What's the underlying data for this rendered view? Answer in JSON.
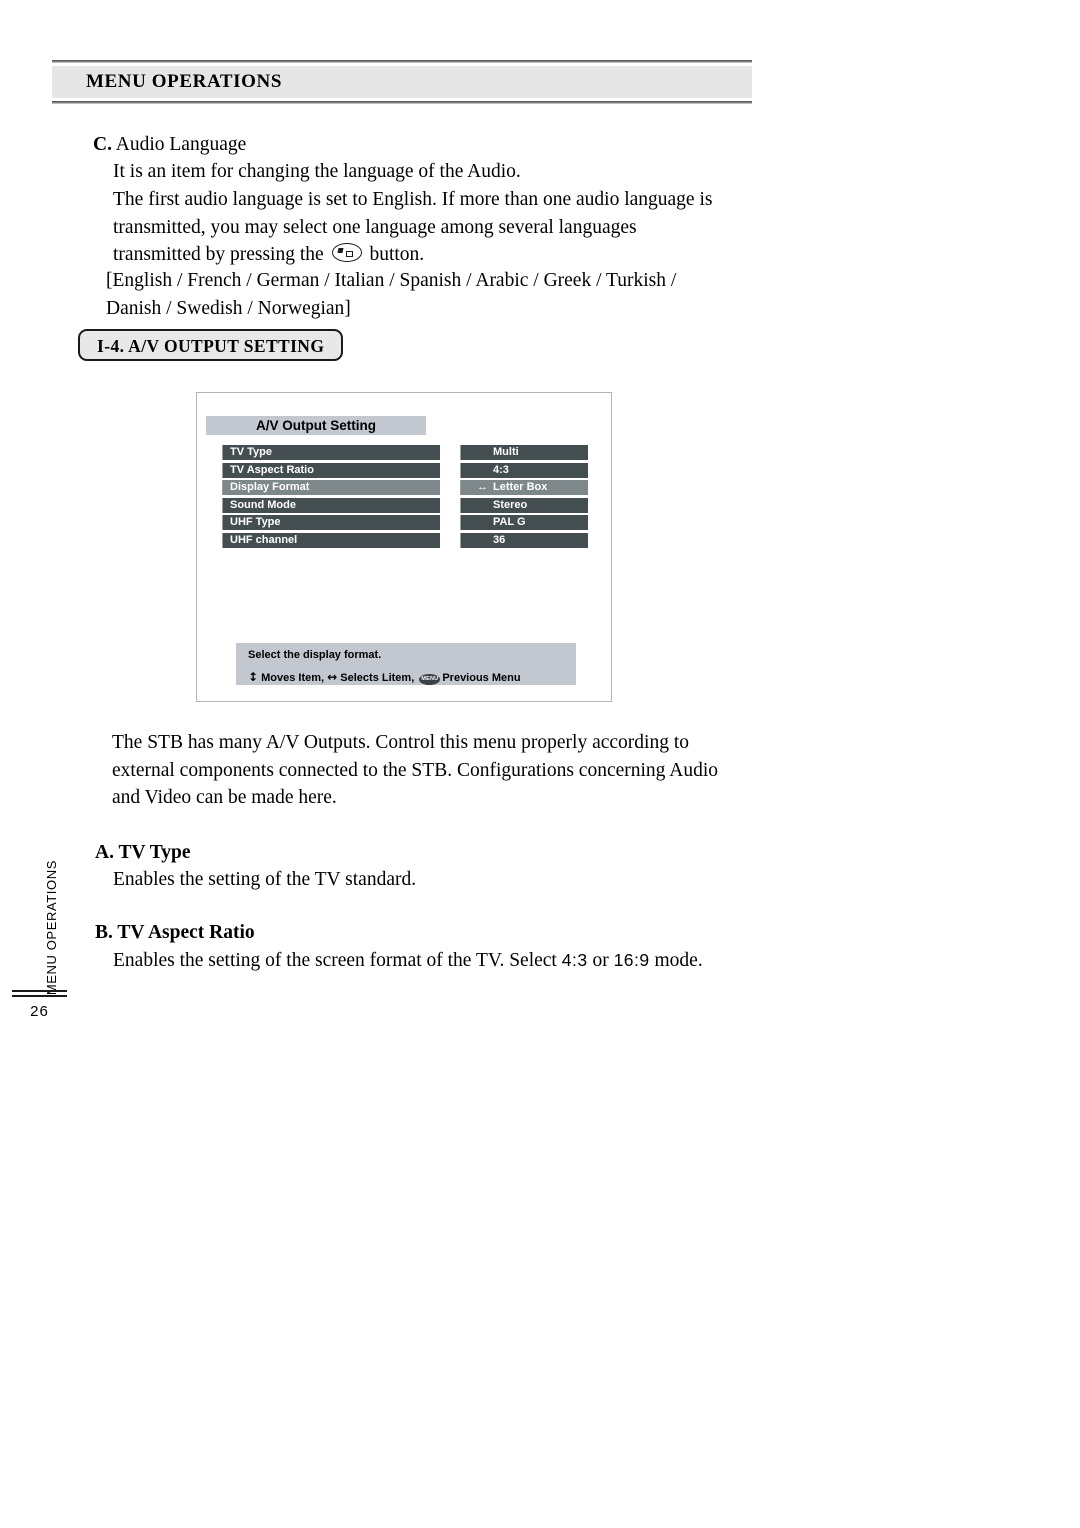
{
  "header": {
    "title": "MENU OPERATIONS"
  },
  "side_tab": {
    "label": "MENU OPERATIONS",
    "page_number": "26"
  },
  "section_c": {
    "letter": "C.",
    "heading": " Audio Language",
    "line1": "It is an item for changing the language of the Audio.",
    "para_before_icon": "The first audio language is set to English. If more than one audio language is transmitted, you may select one language among several languages transmitted by pressing the ",
    "para_after_icon": " button.",
    "icon_name": "audio-button-icon",
    "languages": "[English / French / German / Italian / Spanish / Arabic / Greek / Turkish / Danish / Swedish / Norwegian]"
  },
  "section_pill": {
    "label": "I-4. A/V OUTPUT SETTING"
  },
  "osd": {
    "title": "A/V Output Setting",
    "rows": [
      {
        "label": "TV Type",
        "value": "Multi",
        "selected": false,
        "arrow": ""
      },
      {
        "label": "TV Aspect Ratio",
        "value": "4:3",
        "selected": false,
        "arrow": ""
      },
      {
        "label": "Display Format",
        "value": "Letter Box",
        "selected": true,
        "arrow": "↔"
      },
      {
        "label": "Sound Mode",
        "value": "Stereo",
        "selected": false,
        "arrow": ""
      },
      {
        "label": "UHF Type",
        "value": "PAL G",
        "selected": false,
        "arrow": ""
      },
      {
        "label": "UHF channel",
        "value": "36",
        "selected": false,
        "arrow": ""
      }
    ],
    "help_line1": "Select the display format.",
    "help_updown_glyph": "↕",
    "help_moves": "Moves Item,",
    "help_leftright_glyph": "↔",
    "help_selects": "Selects Litem,",
    "help_menu_button": "MENU",
    "help_previous": "Previous Menu",
    "colors": {
      "row_normal": "#444d50",
      "row_selected": "#7e878a",
      "title_bar": "#c3c8d0",
      "help_bar": "#c3c8d0",
      "row_text": "#ffffff"
    }
  },
  "stb_paragraph": "The STB has many A/V Outputs. Control this menu properly according to external components connected to the STB. Configurations concerning Audio and Video can be made here.",
  "section_a": {
    "heading": "A. TV Type",
    "body": "Enables the setting of the TV standard."
  },
  "section_b": {
    "heading": "B. TV Aspect Ratio",
    "body_part1": "Enables the setting of the screen format of the TV. Select ",
    "ratio1": "4:3",
    "body_part2": " or ",
    "ratio2": "16:9",
    "body_part3": " mode."
  }
}
